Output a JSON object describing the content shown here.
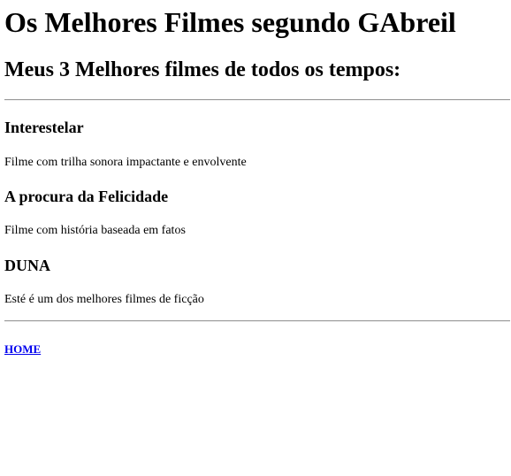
{
  "header": {
    "title": "Os Melhores Filmes segundo GAbreil",
    "subtitle": "Meus 3 Melhores filmes de todos os tempos:"
  },
  "movies": [
    {
      "title": "Interestelar",
      "description": "Filme com trilha sonora impactante e envolvente"
    },
    {
      "title": "A procura da Felicidade",
      "description": "Filme com história baseada em fatos"
    },
    {
      "title": "DUNA",
      "description": "Esté é um dos melhores filmes de ficção"
    }
  ],
  "footer": {
    "home_link": "HOME"
  },
  "colors": {
    "link": "#0000ee",
    "text": "#000000",
    "background": "#ffffff",
    "rule": "#9a9a9a"
  }
}
